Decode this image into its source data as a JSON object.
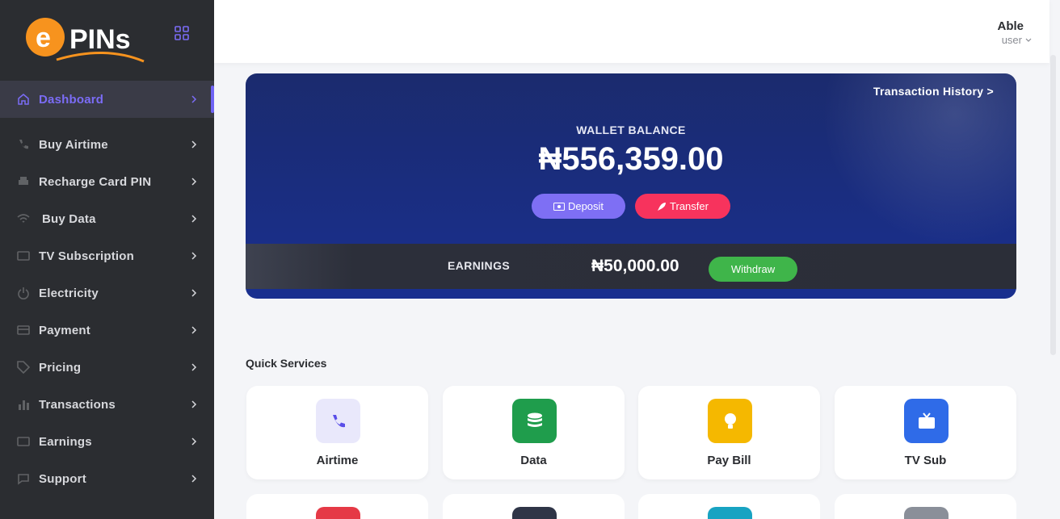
{
  "brand": {
    "logo_letter": "e",
    "logo_text": "PINs",
    "logo_color": "#f7931e"
  },
  "sidebar": {
    "items": [
      {
        "label": "Dashboard",
        "icon": "home-icon",
        "active": true
      },
      {
        "label": "Buy Airtime",
        "icon": "phone-icon"
      },
      {
        "label": "Recharge Card PIN",
        "icon": "printer-icon"
      },
      {
        "label": "Buy Data",
        "icon": "wifi-icon"
      },
      {
        "label": "TV Subscription",
        "icon": "tv-icon"
      },
      {
        "label": "Electricity",
        "icon": "power-icon"
      },
      {
        "label": "Payment",
        "icon": "card-icon"
      },
      {
        "label": "Pricing",
        "icon": "tag-icon"
      },
      {
        "label": "Transactions",
        "icon": "bars-icon"
      },
      {
        "label": "Earnings",
        "icon": "wallet-icon"
      },
      {
        "label": "Support",
        "icon": "chat-icon"
      }
    ]
  },
  "header": {
    "user_name": "Able",
    "user_role": "user"
  },
  "wallet": {
    "history_link": "Transaction History >",
    "balance_label": "WALLET BALANCE",
    "balance_amount": "₦556,359.00",
    "deposit_label": "Deposit",
    "transfer_label": "Transfer",
    "earnings_label": "EARNINGS",
    "earnings_amount": "₦50,000.00",
    "withdraw_label": "Withdraw"
  },
  "quick_services": {
    "title": "Quick Services",
    "items": [
      {
        "label": "Airtime",
        "icon": "phone-icon",
        "color": "#e9e8fb"
      },
      {
        "label": "Data",
        "icon": "database-icon",
        "color": "#1f9d4c"
      },
      {
        "label": "Pay Bill",
        "icon": "bulb-icon",
        "color": "#f5b800"
      },
      {
        "label": "TV Sub",
        "icon": "tv-icon",
        "color": "#2f6be8"
      }
    ],
    "partial_colors": [
      "#e53946",
      "#2f3547",
      "#18a3c2",
      "#8a8f99"
    ]
  },
  "colors": {
    "accent": "#7b6cf6",
    "sidebar_bg": "#2b2d31",
    "wallet_bg": "#192f8f"
  }
}
